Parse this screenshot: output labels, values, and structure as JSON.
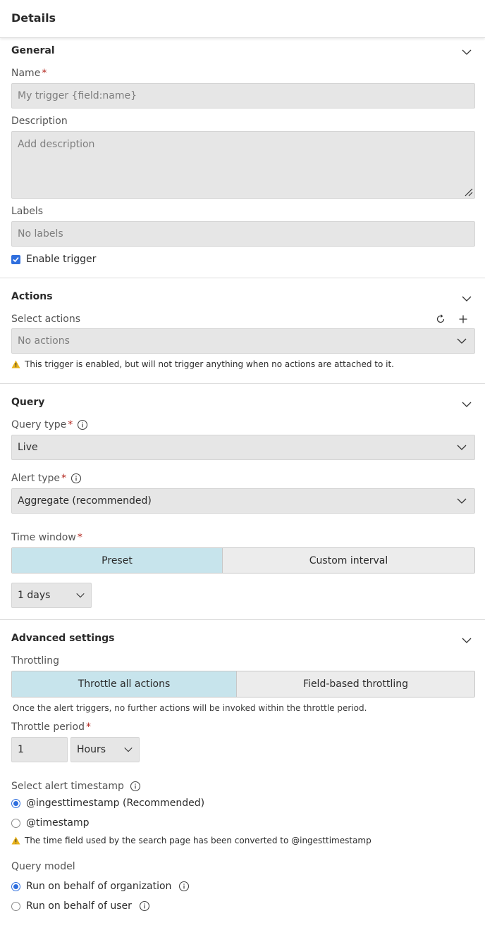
{
  "header": {
    "title": "Details"
  },
  "general": {
    "title": "General",
    "name_label": "Name",
    "name_placeholder": "My trigger {field:name}",
    "description_label": "Description",
    "description_placeholder": "Add description",
    "labels_label": "Labels",
    "labels_placeholder": "No labels",
    "enable_label": "Enable trigger"
  },
  "actions": {
    "title": "Actions",
    "select_label": "Select actions",
    "select_placeholder": "No actions",
    "warning": "This trigger is enabled, but will not trigger anything when no actions are attached to it."
  },
  "query": {
    "title": "Query",
    "query_type_label": "Query type",
    "query_type_value": "Live",
    "alert_type_label": "Alert type",
    "alert_type_value": "Aggregate (recommended)",
    "time_window_label": "Time window",
    "time_window_options": [
      "Preset",
      "Custom interval"
    ],
    "time_window_value": "1 days"
  },
  "advanced": {
    "title": "Advanced settings",
    "throttling_label": "Throttling",
    "throttling_options": [
      "Throttle all actions",
      "Field-based throttling"
    ],
    "throttling_hint": "Once the alert triggers, no further actions will be invoked within the throttle period.",
    "throttle_period_label": "Throttle period",
    "throttle_period_value": "1",
    "throttle_period_unit": "Hours",
    "timestamp_label": "Select alert timestamp",
    "timestamp_options": [
      "@ingesttimestamp (Recommended)",
      "@timestamp"
    ],
    "timestamp_warning": "The time field used by the search page has been converted to @ingesttimestamp",
    "query_model_label": "Query model",
    "query_model_options": [
      "Run on behalf of organization",
      "Run on behalf of user"
    ]
  },
  "colors": {
    "accent": "#2f6fde",
    "segment_active": "#c7e4ec",
    "required": "#b3261e",
    "warning": "#e8b21a"
  }
}
